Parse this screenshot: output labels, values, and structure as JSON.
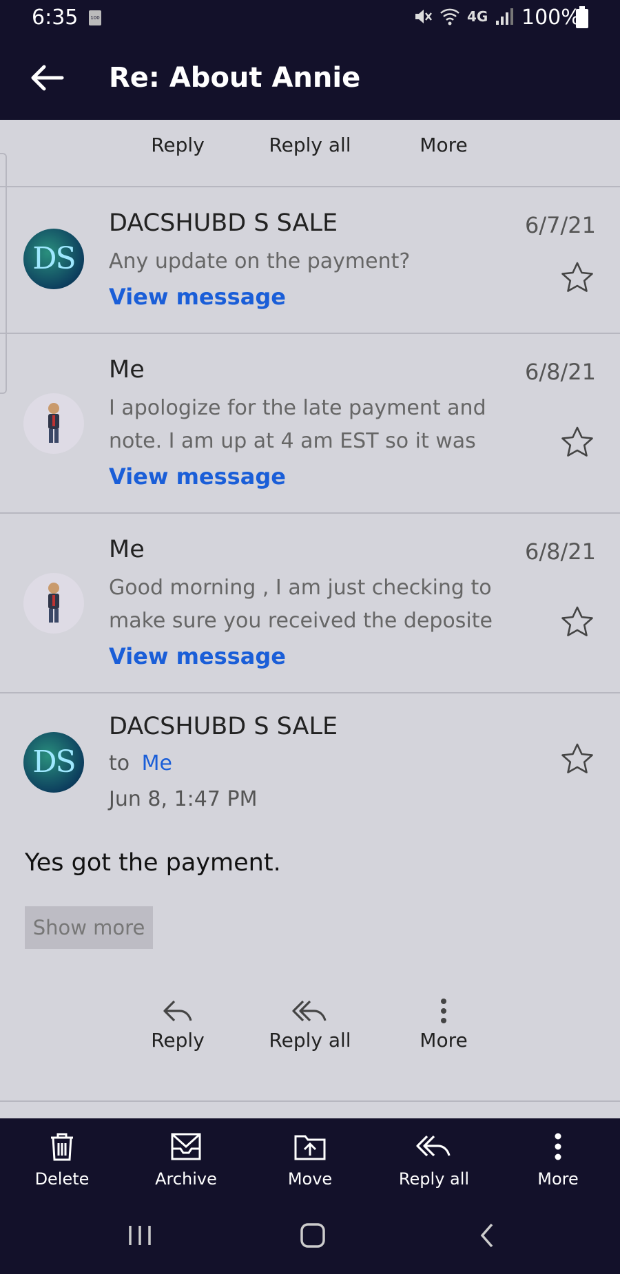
{
  "status": {
    "time": "6:35",
    "sim_label": "100",
    "battery_pct": "100%",
    "network": "4G"
  },
  "header": {
    "title": "Re: About Annie"
  },
  "top_actions": {
    "reply": "Reply",
    "reply_all": "Reply all",
    "more": "More"
  },
  "messages": [
    {
      "sender": "DACSHUBD S SALE",
      "date": "6/7/21",
      "preview": "Any update on the payment?",
      "link": "View message",
      "avatar_initials": "DS"
    },
    {
      "sender": "Me",
      "date": "6/8/21",
      "preview_lines": [
        "I apologize for the late payment and",
        "note. I am up at 4 am EST so it was"
      ],
      "link": "View message"
    },
    {
      "sender": "Me",
      "date": "6/8/21",
      "preview_lines": [
        "Good morning , I am just checking to",
        "make sure you received the deposite"
      ],
      "link": "View message"
    }
  ],
  "expanded": {
    "sender": "DACSHUBD S SALE",
    "avatar_initials": "DS",
    "to_label": "to",
    "recipient": "Me",
    "datetime": "Jun 8, 1:47 PM",
    "body": "Yes got the payment.",
    "show_more": "Show more",
    "actions": {
      "reply": "Reply",
      "reply_all": "Reply all",
      "more": "More"
    }
  },
  "toolbar": {
    "delete": "Delete",
    "archive": "Archive",
    "move": "Move",
    "reply_all": "Reply all",
    "more": "More"
  },
  "colors": {
    "bar": "#13112a",
    "background": "#d4d4db",
    "link": "#1a5ed8"
  }
}
